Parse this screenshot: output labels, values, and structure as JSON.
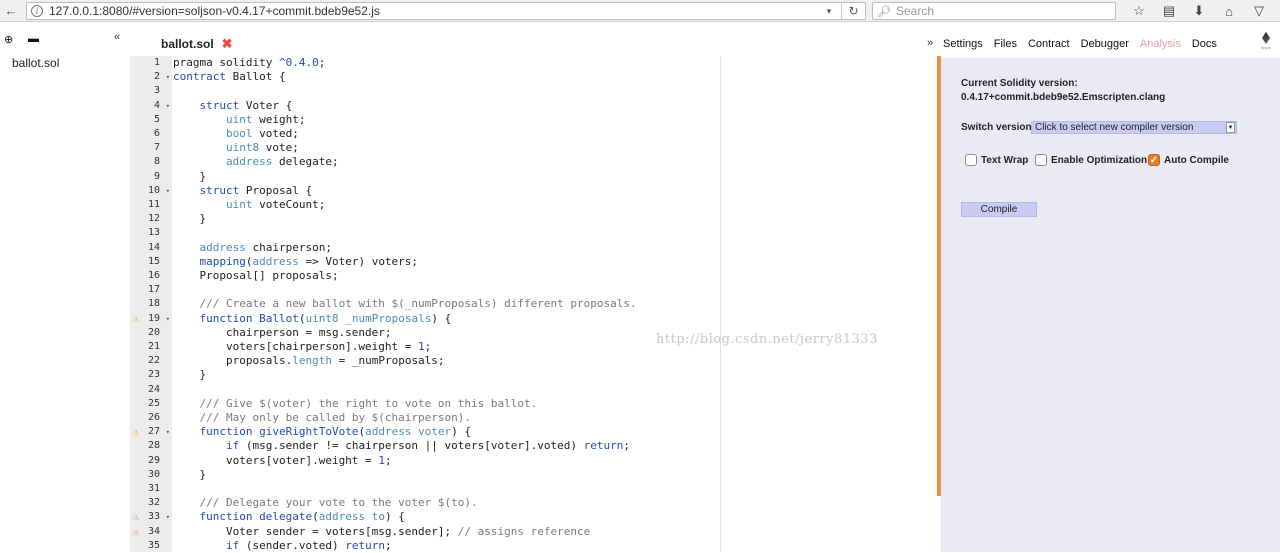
{
  "browser": {
    "url": "127.0.0.1:8080/#version=soljson-v0.4.17+commit.bdeb9e52.js",
    "search_placeholder": "Search"
  },
  "file_explorer": {
    "files": [
      "ballot.sol"
    ]
  },
  "editor": {
    "active_tab": "ballot.sol",
    "watermark": "http://blog.csdn.net/jerry81333",
    "warning_lines": [
      19,
      27,
      33,
      34
    ],
    "fold_lines": [
      2,
      4,
      10,
      19,
      27,
      33
    ],
    "lines": [
      [
        [
          "plain",
          "pragma solidity "
        ],
        [
          "str",
          "^0.4.0"
        ],
        [
          "plain",
          ";"
        ]
      ],
      [
        [
          "kw",
          "contract"
        ],
        [
          "plain",
          " Ballot {"
        ]
      ],
      [],
      [
        [
          "plain",
          "    "
        ],
        [
          "kw",
          "struct"
        ],
        [
          "plain",
          " Voter {"
        ]
      ],
      [
        [
          "plain",
          "        "
        ],
        [
          "ty",
          "uint"
        ],
        [
          "plain",
          " weight;"
        ]
      ],
      [
        [
          "plain",
          "        "
        ],
        [
          "ty",
          "bool"
        ],
        [
          "plain",
          " voted;"
        ]
      ],
      [
        [
          "plain",
          "        "
        ],
        [
          "ty",
          "uint8"
        ],
        [
          "plain",
          " vote;"
        ]
      ],
      [
        [
          "plain",
          "        "
        ],
        [
          "ty",
          "address"
        ],
        [
          "plain",
          " delegate;"
        ]
      ],
      [
        [
          "plain",
          "    }"
        ]
      ],
      [
        [
          "plain",
          "    "
        ],
        [
          "kw",
          "struct"
        ],
        [
          "plain",
          " Proposal {"
        ]
      ],
      [
        [
          "plain",
          "        "
        ],
        [
          "ty",
          "uint"
        ],
        [
          "plain",
          " voteCount;"
        ]
      ],
      [
        [
          "plain",
          "    }"
        ]
      ],
      [],
      [
        [
          "plain",
          "    "
        ],
        [
          "ty",
          "address"
        ],
        [
          "plain",
          " chairperson;"
        ]
      ],
      [
        [
          "plain",
          "    "
        ],
        [
          "kw",
          "mapping"
        ],
        [
          "plain",
          "("
        ],
        [
          "ty",
          "address"
        ],
        [
          "plain",
          " => Voter) voters;"
        ]
      ],
      [
        [
          "plain",
          "    Proposal[] proposals;"
        ]
      ],
      [],
      [
        [
          "plain",
          "    "
        ],
        [
          "cm",
          "/// Create a new ballot with $(_numProposals) different proposals."
        ]
      ],
      [
        [
          "plain",
          "    "
        ],
        [
          "kw",
          "function"
        ],
        [
          "plain",
          " "
        ],
        [
          "fn",
          "Ballot"
        ],
        [
          "plain",
          "("
        ],
        [
          "ty",
          "uint8"
        ],
        [
          "plain",
          " "
        ],
        [
          "ty",
          "_numProposals"
        ],
        [
          "plain",
          ") {"
        ]
      ],
      [
        [
          "plain",
          "        chairperson = msg.sender;"
        ]
      ],
      [
        [
          "plain",
          "        voters[chairperson].weight = "
        ],
        [
          "num",
          "1"
        ],
        [
          "plain",
          ";"
        ]
      ],
      [
        [
          "plain",
          "        proposals."
        ],
        [
          "ty",
          "length"
        ],
        [
          "plain",
          " = _numProposals;"
        ]
      ],
      [
        [
          "plain",
          "    }"
        ]
      ],
      [],
      [
        [
          "plain",
          "    "
        ],
        [
          "cm",
          "/// Give $(voter) the right to vote on this ballot."
        ]
      ],
      [
        [
          "plain",
          "    "
        ],
        [
          "cm",
          "/// May only be called by $(chairperson)."
        ]
      ],
      [
        [
          "plain",
          "    "
        ],
        [
          "kw",
          "function"
        ],
        [
          "plain",
          " "
        ],
        [
          "fn",
          "giveRightToVote"
        ],
        [
          "plain",
          "("
        ],
        [
          "ty",
          "address"
        ],
        [
          "plain",
          " "
        ],
        [
          "ty",
          "voter"
        ],
        [
          "plain",
          ") {"
        ]
      ],
      [
        [
          "plain",
          "        "
        ],
        [
          "kw",
          "if"
        ],
        [
          "plain",
          " (msg.sender != chairperson || voters[voter].voted) "
        ],
        [
          "kw",
          "return"
        ],
        [
          "plain",
          ";"
        ]
      ],
      [
        [
          "plain",
          "        voters[voter].weight = "
        ],
        [
          "num",
          "1"
        ],
        [
          "plain",
          ";"
        ]
      ],
      [
        [
          "plain",
          "    }"
        ]
      ],
      [],
      [
        [
          "plain",
          "    "
        ],
        [
          "cm",
          "/// Delegate your vote to the voter $(to)."
        ]
      ],
      [
        [
          "plain",
          "    "
        ],
        [
          "kw",
          "function"
        ],
        [
          "plain",
          " "
        ],
        [
          "fn",
          "delegate"
        ],
        [
          "plain",
          "("
        ],
        [
          "ty",
          "address"
        ],
        [
          "plain",
          " "
        ],
        [
          "ty",
          "to"
        ],
        [
          "plain",
          ") {"
        ]
      ],
      [
        [
          "plain",
          "        Voter sender = voters[msg.sender]; "
        ],
        [
          "cm",
          "// assigns reference"
        ]
      ],
      [
        [
          "plain",
          "        "
        ],
        [
          "kw",
          "if"
        ],
        [
          "plain",
          " (sender.voted) "
        ],
        [
          "kw",
          "return"
        ],
        [
          "plain",
          ";"
        ]
      ]
    ]
  },
  "right_panel": {
    "tabs": [
      "Settings",
      "Files",
      "Contract",
      "Debugger",
      "Analysis",
      "Docs"
    ],
    "current_version_label": "Current Solidity version:",
    "current_version_value": "0.4.17+commit.bdeb9e52.Emscripten.clang",
    "switch_version_label": "Switch version:",
    "switch_version_value": "Click to select new compiler version",
    "options": [
      {
        "label": "Text Wrap",
        "checked": false
      },
      {
        "label": "Enable Optimization",
        "checked": false
      },
      {
        "label": "Auto Compile",
        "checked": true
      }
    ],
    "compile_label": "Compile",
    "logo_text": "ripple"
  },
  "colors": {
    "accent": "#e67e22",
    "panel_bg": "#eaeaf6",
    "button_bg": "#c9cbf2",
    "keyword": "#1f4eb4",
    "type": "#4c8db6",
    "comment": "#7a7a7a"
  }
}
